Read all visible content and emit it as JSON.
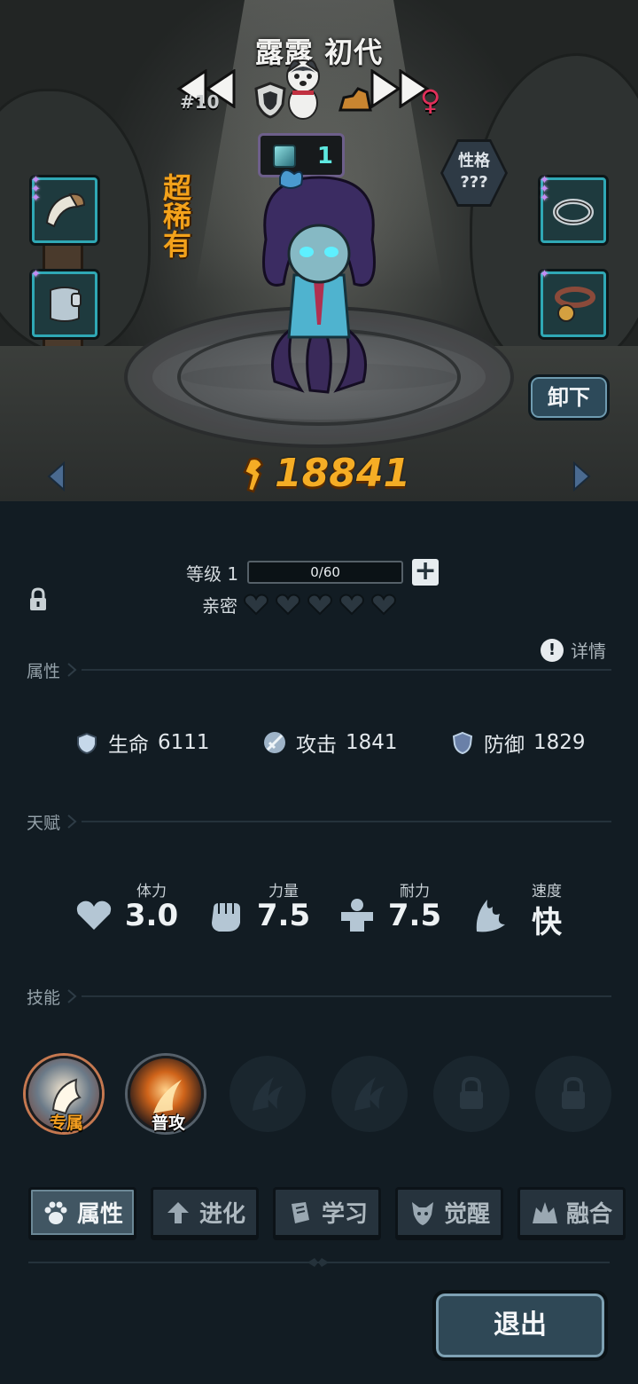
{
  "character": {
    "name": "露露 初代",
    "rank": "#10",
    "rarity": "超稀有",
    "gem_count": "1",
    "personality_label": "性格",
    "personality_value": "???",
    "power": "18841"
  },
  "buttons": {
    "unload": "卸下",
    "exit": "退出"
  },
  "level": {
    "label": "等级 1",
    "xp_text": "0/60",
    "xp_fraction": 0,
    "plus": "+"
  },
  "intimacy": {
    "label": "亲密",
    "hearts_filled": 0,
    "hearts_total": 5
  },
  "detail_link": "详情",
  "sections": {
    "attributes": "属性",
    "talent": "天赋",
    "skills": "技能"
  },
  "attributes": [
    {
      "name": "生命",
      "value": "6111"
    },
    {
      "name": "攻击",
      "value": "1841"
    },
    {
      "name": "防御",
      "value": "1829"
    }
  ],
  "talents": [
    {
      "name": "体力",
      "value": "3.0",
      "icon": "heart-icon"
    },
    {
      "name": "力量",
      "value": "7.5",
      "icon": "fist-icon"
    },
    {
      "name": "耐力",
      "value": "7.5",
      "icon": "muscle-icon"
    },
    {
      "name": "速度",
      "value": "快",
      "icon": "wing-icon"
    }
  ],
  "skills": [
    {
      "label": "专属",
      "state": "active"
    },
    {
      "label": "普攻",
      "state": "active"
    },
    {
      "label": "",
      "state": "empty"
    },
    {
      "label": "",
      "state": "empty"
    },
    {
      "label": "",
      "state": "locked"
    },
    {
      "label": "",
      "state": "locked"
    }
  ],
  "tabs": [
    {
      "label": "属性",
      "icon": "paw-icon",
      "active": true
    },
    {
      "label": "进化",
      "icon": "arrow-up-icon",
      "active": false
    },
    {
      "label": "学习",
      "icon": "book-icon",
      "active": false
    },
    {
      "label": "觉醒",
      "icon": "wolf-icon",
      "active": false
    },
    {
      "label": "融合",
      "icon": "fusion-icon",
      "active": false
    }
  ],
  "colors": {
    "power": "#f5ad25",
    "rarity": "#f3a21b",
    "gem_text": "#5ee8e0",
    "gender": "#e0305a",
    "panel_bg": "#121c23"
  }
}
